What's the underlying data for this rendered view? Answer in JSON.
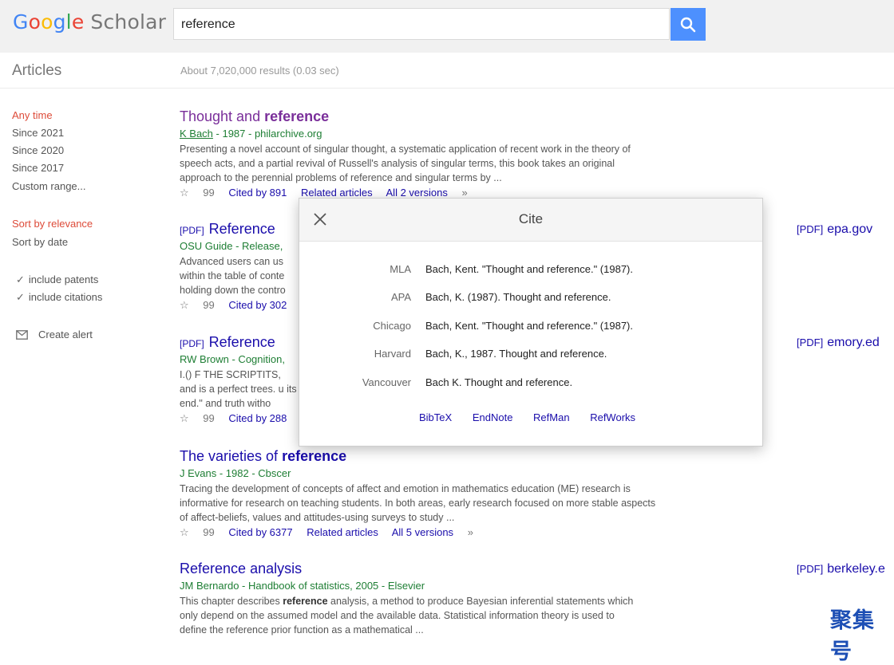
{
  "header": {
    "logo_letters": [
      "G",
      "o",
      "o",
      "g",
      "l",
      "e"
    ],
    "logo_suffix": "Scholar",
    "search_value": "reference"
  },
  "subheader": {
    "section": "Articles",
    "results_count": "About 7,020,000 results (0.03 sec)"
  },
  "sidebar": {
    "time_filters": [
      "Any time",
      "Since 2021",
      "Since 2020",
      "Since 2017",
      "Custom range..."
    ],
    "sort_options": [
      "Sort by relevance",
      "Sort by date"
    ],
    "checks": [
      "include patents",
      "include citations"
    ],
    "create_alert": "Create alert"
  },
  "results": [
    {
      "title_pre": "Thought and ",
      "title_bold": "reference",
      "title_post": "",
      "author": "K Bach",
      "meta_rest": " - 1987 - philarchive.org",
      "snippet": "Presenting a novel account of singular thought, a systematic application of recent work in the theory of speech acts, and a partial revival of Russell's analysis of singular terms, this book takes an original approach to the perennial problems of reference and singular terms by ...",
      "actions": [
        "☆",
        "99",
        "Cited by 891",
        "Related articles",
        "All 2 versions",
        "»"
      ]
    },
    {
      "pdf": "[PDF]",
      "title": "Reference",
      "meta": "OSU Guide - Release,",
      "snippet": "Advanced users can us within the table of conte holding down the contro",
      "actions": [
        "☆",
        "99",
        "Cited by 302"
      ],
      "side_link": {
        "tag": "[PDF]",
        "site": "epa.gov"
      }
    },
    {
      "pdf": "[PDF]",
      "title": "Reference",
      "meta": "RW Brown - Cognition,",
      "snippet": "I.() F THE SCRIPTITS, and is a perfect trees. u its end.\" and truth witho",
      "actions": [
        "☆",
        "99",
        "Cited by 288"
      ],
      "side_link": {
        "tag": "[PDF]",
        "site": "emory.ed"
      }
    },
    {
      "title_pre": "The varieties of ",
      "title_bold": "reference",
      "meta": "J Evans - 1982 - Cbscer",
      "snippet": "Tracing the development of concepts of affect and emotion in mathematics education (ME) research is informative for research on teaching students. In both areas, early research focused on more stable aspects of affect-beliefs, values and attitudes-using surveys to study ...",
      "actions": [
        "☆",
        "99",
        "Cited by 6377",
        "Related articles",
        "All 5 versions",
        "»"
      ]
    },
    {
      "title_pre": "Reference",
      "title_bold": "",
      "title_post": " analysis",
      "meta": "JM Bernardo - Handbook of statistics, 2005 - Elsevier",
      "snippet_pre": "This chapter describes ",
      "snippet_bold": "reference",
      "snippet_post": " analysis, a method to produce Bayesian inferential statements which only depend on the assumed model and the available data. Statistical information theory is used to define the reference prior function as a mathematical ...",
      "side_link": {
        "tag": "[PDF]",
        "site": "berkeley.e"
      }
    }
  ],
  "cite_dialog": {
    "title": "Cite",
    "rows": [
      {
        "style": "MLA",
        "text": "Bach, Kent. \"Thought and reference.\" (1987)."
      },
      {
        "style": "APA",
        "text": "Bach, K. (1987). Thought and reference."
      },
      {
        "style": "Chicago",
        "text": "Bach, Kent. \"Thought and reference.\" (1987)."
      },
      {
        "style": "Harvard",
        "text": "Bach, K., 1987. Thought and reference."
      },
      {
        "style": "Vancouver",
        "text": "Bach K. Thought and reference."
      }
    ],
    "exports": [
      "BibTeX",
      "EndNote",
      "RefMan",
      "RefWorks"
    ]
  },
  "watermark": "聚集号",
  "colors": {
    "link": "#1a0dab",
    "visited": "#7a2e9a",
    "meta_green": "#1e7e34",
    "accent_red": "#dd4b39",
    "search_blue": "#4d90fe"
  }
}
